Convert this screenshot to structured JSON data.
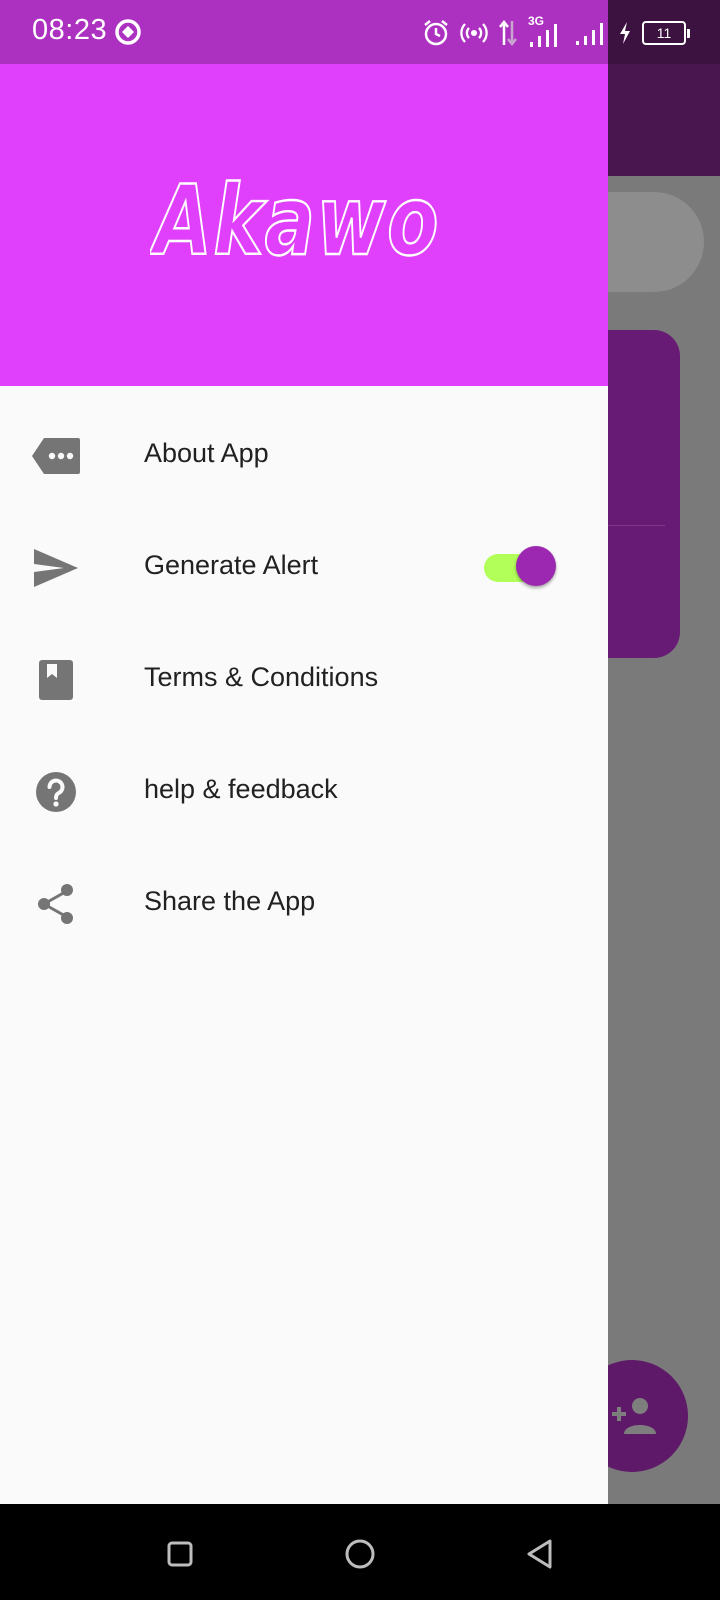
{
  "status_bar": {
    "time": "08:23",
    "network_type": "3G",
    "battery_level": "11",
    "icons": [
      "data-saver-icon",
      "alarm-icon",
      "hotspot-icon",
      "data-transfer-icon",
      "signal-icon",
      "signal-icon",
      "charging-icon",
      "battery-icon"
    ]
  },
  "drawer": {
    "header": {
      "brand": "Akawo",
      "background_color": "#e040fb"
    },
    "items": [
      {
        "label": "About App",
        "icon": "label-more-icon"
      },
      {
        "label": "Generate Alert",
        "icon": "send-icon",
        "toggle": {
          "on": true,
          "track_color": "#b2ff59",
          "thumb_color": "#9c27b0"
        }
      },
      {
        "label": "Terms & Conditions",
        "icon": "book-icon"
      },
      {
        "label": "help & feedback",
        "icon": "help-icon"
      },
      {
        "label": "Share the App",
        "icon": "share-icon"
      }
    ]
  },
  "background_app": {
    "fab_icon": "add-person-icon",
    "accent_color": "#9c27b0"
  },
  "nav_bar": {
    "buttons": [
      "recents-icon",
      "home-icon",
      "back-icon"
    ]
  }
}
